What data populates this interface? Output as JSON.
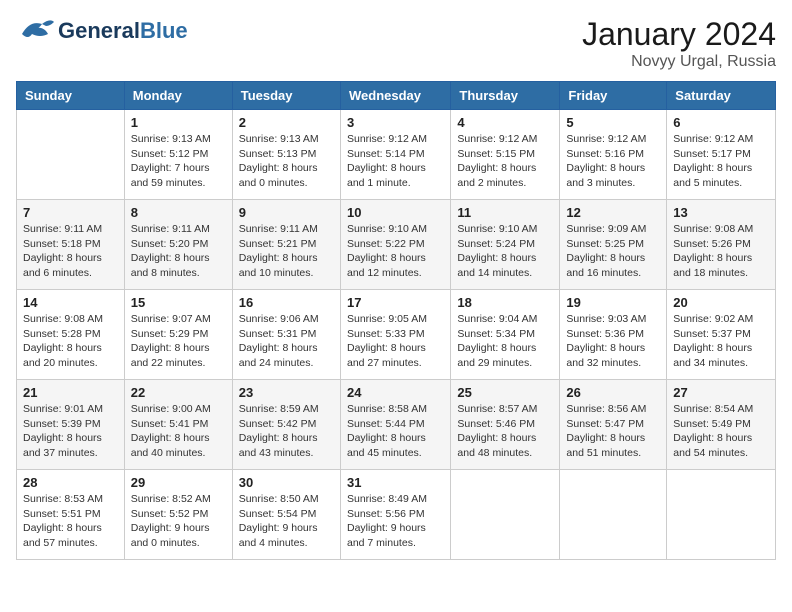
{
  "header": {
    "logo_general": "General",
    "logo_blue": "Blue",
    "month": "January 2024",
    "location": "Novyy Urgal, Russia"
  },
  "weekdays": [
    "Sunday",
    "Monday",
    "Tuesday",
    "Wednesday",
    "Thursday",
    "Friday",
    "Saturday"
  ],
  "weeks": [
    [
      {
        "day": "",
        "info": ""
      },
      {
        "day": "1",
        "info": "Sunrise: 9:13 AM\nSunset: 5:12 PM\nDaylight: 7 hours\nand 59 minutes."
      },
      {
        "day": "2",
        "info": "Sunrise: 9:13 AM\nSunset: 5:13 PM\nDaylight: 8 hours\nand 0 minutes."
      },
      {
        "day": "3",
        "info": "Sunrise: 9:12 AM\nSunset: 5:14 PM\nDaylight: 8 hours\nand 1 minute."
      },
      {
        "day": "4",
        "info": "Sunrise: 9:12 AM\nSunset: 5:15 PM\nDaylight: 8 hours\nand 2 minutes."
      },
      {
        "day": "5",
        "info": "Sunrise: 9:12 AM\nSunset: 5:16 PM\nDaylight: 8 hours\nand 3 minutes."
      },
      {
        "day": "6",
        "info": "Sunrise: 9:12 AM\nSunset: 5:17 PM\nDaylight: 8 hours\nand 5 minutes."
      }
    ],
    [
      {
        "day": "7",
        "info": "Sunrise: 9:11 AM\nSunset: 5:18 PM\nDaylight: 8 hours\nand 6 minutes."
      },
      {
        "day": "8",
        "info": "Sunrise: 9:11 AM\nSunset: 5:20 PM\nDaylight: 8 hours\nand 8 minutes."
      },
      {
        "day": "9",
        "info": "Sunrise: 9:11 AM\nSunset: 5:21 PM\nDaylight: 8 hours\nand 10 minutes."
      },
      {
        "day": "10",
        "info": "Sunrise: 9:10 AM\nSunset: 5:22 PM\nDaylight: 8 hours\nand 12 minutes."
      },
      {
        "day": "11",
        "info": "Sunrise: 9:10 AM\nSunset: 5:24 PM\nDaylight: 8 hours\nand 14 minutes."
      },
      {
        "day": "12",
        "info": "Sunrise: 9:09 AM\nSunset: 5:25 PM\nDaylight: 8 hours\nand 16 minutes."
      },
      {
        "day": "13",
        "info": "Sunrise: 9:08 AM\nSunset: 5:26 PM\nDaylight: 8 hours\nand 18 minutes."
      }
    ],
    [
      {
        "day": "14",
        "info": "Sunrise: 9:08 AM\nSunset: 5:28 PM\nDaylight: 8 hours\nand 20 minutes."
      },
      {
        "day": "15",
        "info": "Sunrise: 9:07 AM\nSunset: 5:29 PM\nDaylight: 8 hours\nand 22 minutes."
      },
      {
        "day": "16",
        "info": "Sunrise: 9:06 AM\nSunset: 5:31 PM\nDaylight: 8 hours\nand 24 minutes."
      },
      {
        "day": "17",
        "info": "Sunrise: 9:05 AM\nSunset: 5:33 PM\nDaylight: 8 hours\nand 27 minutes."
      },
      {
        "day": "18",
        "info": "Sunrise: 9:04 AM\nSunset: 5:34 PM\nDaylight: 8 hours\nand 29 minutes."
      },
      {
        "day": "19",
        "info": "Sunrise: 9:03 AM\nSunset: 5:36 PM\nDaylight: 8 hours\nand 32 minutes."
      },
      {
        "day": "20",
        "info": "Sunrise: 9:02 AM\nSunset: 5:37 PM\nDaylight: 8 hours\nand 34 minutes."
      }
    ],
    [
      {
        "day": "21",
        "info": "Sunrise: 9:01 AM\nSunset: 5:39 PM\nDaylight: 8 hours\nand 37 minutes."
      },
      {
        "day": "22",
        "info": "Sunrise: 9:00 AM\nSunset: 5:41 PM\nDaylight: 8 hours\nand 40 minutes."
      },
      {
        "day": "23",
        "info": "Sunrise: 8:59 AM\nSunset: 5:42 PM\nDaylight: 8 hours\nand 43 minutes."
      },
      {
        "day": "24",
        "info": "Sunrise: 8:58 AM\nSunset: 5:44 PM\nDaylight: 8 hours\nand 45 minutes."
      },
      {
        "day": "25",
        "info": "Sunrise: 8:57 AM\nSunset: 5:46 PM\nDaylight: 8 hours\nand 48 minutes."
      },
      {
        "day": "26",
        "info": "Sunrise: 8:56 AM\nSunset: 5:47 PM\nDaylight: 8 hours\nand 51 minutes."
      },
      {
        "day": "27",
        "info": "Sunrise: 8:54 AM\nSunset: 5:49 PM\nDaylight: 8 hours\nand 54 minutes."
      }
    ],
    [
      {
        "day": "28",
        "info": "Sunrise: 8:53 AM\nSunset: 5:51 PM\nDaylight: 8 hours\nand 57 minutes."
      },
      {
        "day": "29",
        "info": "Sunrise: 8:52 AM\nSunset: 5:52 PM\nDaylight: 9 hours\nand 0 minutes."
      },
      {
        "day": "30",
        "info": "Sunrise: 8:50 AM\nSunset: 5:54 PM\nDaylight: 9 hours\nand 4 minutes."
      },
      {
        "day": "31",
        "info": "Sunrise: 8:49 AM\nSunset: 5:56 PM\nDaylight: 9 hours\nand 7 minutes."
      },
      {
        "day": "",
        "info": ""
      },
      {
        "day": "",
        "info": ""
      },
      {
        "day": "",
        "info": ""
      }
    ]
  ]
}
